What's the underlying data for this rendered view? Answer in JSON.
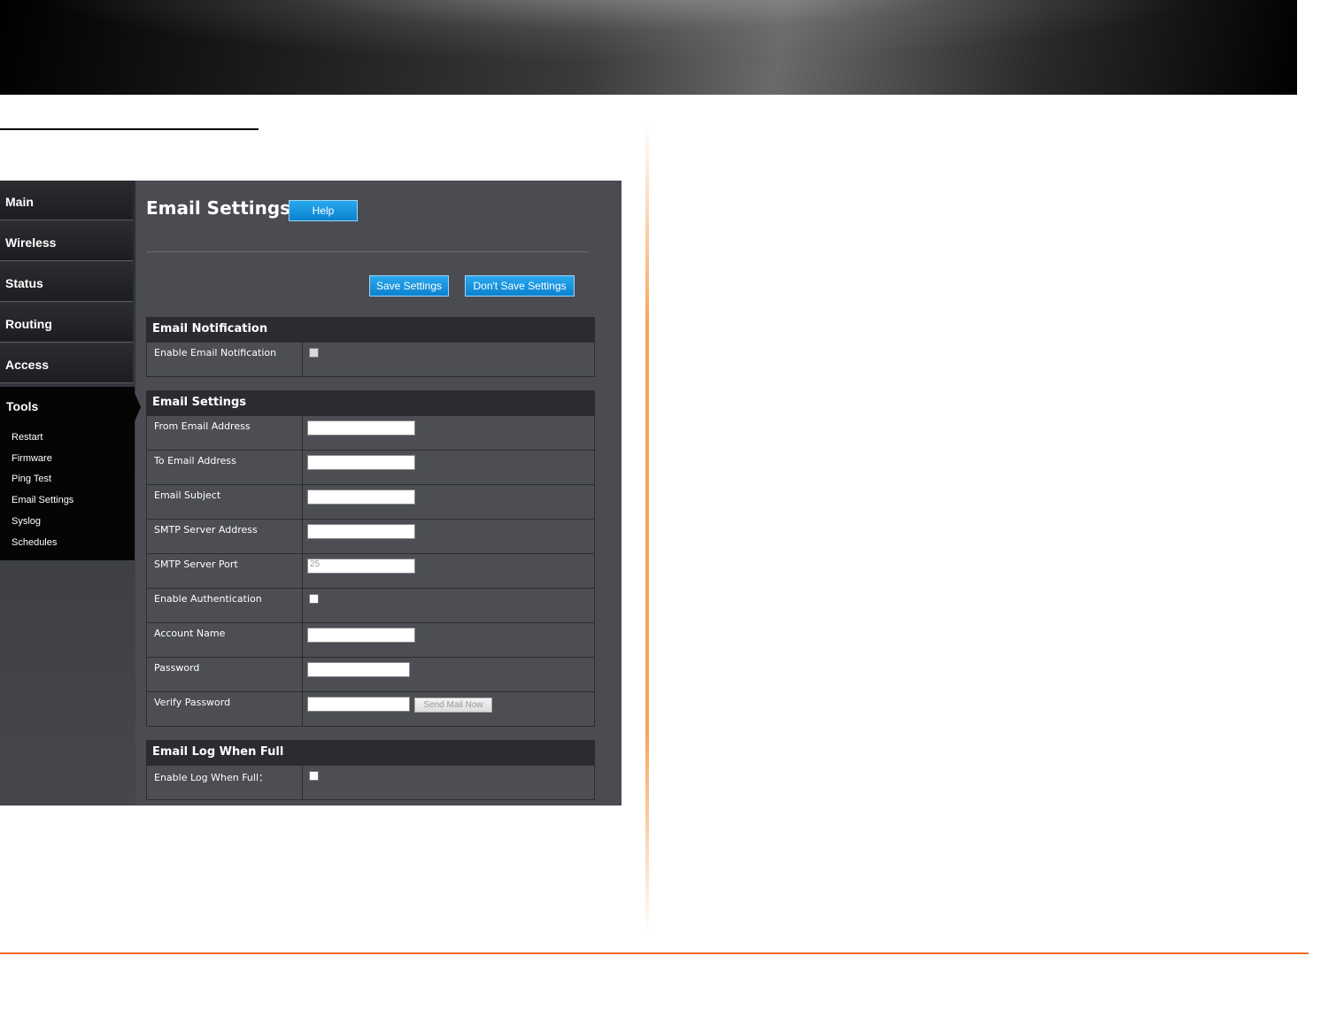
{
  "sidebar": {
    "items": [
      {
        "label": "Main"
      },
      {
        "label": "Wireless"
      },
      {
        "label": "Status"
      },
      {
        "label": "Routing"
      },
      {
        "label": "Access"
      }
    ],
    "tools": {
      "label": "Tools",
      "subitems": [
        "Restart",
        "Firmware",
        "Ping Test",
        "Email Settings",
        "Syslog",
        "Schedules"
      ]
    }
  },
  "header": {
    "title": "Email Settings",
    "help_label": "Help"
  },
  "actions": {
    "save_label": "Save Settings",
    "dont_save_label": "Don't Save Settings"
  },
  "sections": {
    "notification": {
      "title": "Email Notification",
      "enable_label": "Enable Email Notification"
    },
    "settings": {
      "title": "Email Settings",
      "from_label": "From Email Address",
      "to_label": "To Email Address",
      "subject_label": "Email Subject",
      "smtp_address_label": "SMTP Server Address",
      "smtp_port_label": "SMTP Server Port",
      "smtp_port_value": "25",
      "auth_label": "Enable Authentication",
      "account_label": "Account Name",
      "password_label": "Password",
      "verify_label": "Verify Password",
      "send_mail_label": "Send Mail Now"
    },
    "log_full": {
      "title": "Email Log When Full",
      "enable_label": "Enable Log When Full："
    }
  },
  "colors": {
    "accent_blue": "#0b82cf",
    "footer_orange": "#f26a21"
  }
}
